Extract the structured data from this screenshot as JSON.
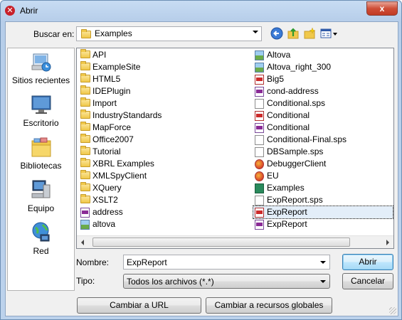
{
  "window": {
    "title": "Abrir",
    "close_glyph": "x"
  },
  "toolbar": {
    "lookin_label": "Buscar en:",
    "lookin_value": "Examples",
    "icons": [
      "back-icon",
      "up-folder-icon",
      "new-folder-icon",
      "view-menu-icon"
    ]
  },
  "places": [
    {
      "label": "Sitios recientes",
      "icon": "recent-places-icon"
    },
    {
      "label": "Escritorio",
      "icon": "desktop-icon"
    },
    {
      "label": "Bibliotecas",
      "icon": "libraries-icon"
    },
    {
      "label": "Equipo",
      "icon": "computer-icon"
    },
    {
      "label": "Red",
      "icon": "network-icon"
    }
  ],
  "files_col1": [
    {
      "name": "API",
      "type": "folder"
    },
    {
      "name": "ExampleSite",
      "type": "folder"
    },
    {
      "name": "HTML5",
      "type": "folder"
    },
    {
      "name": "IDEPlugin",
      "type": "folder"
    },
    {
      "name": "Import",
      "type": "folder"
    },
    {
      "name": "IndustryStandards",
      "type": "folder"
    },
    {
      "name": "MapForce",
      "type": "folder"
    },
    {
      "name": "Office2007",
      "type": "folder"
    },
    {
      "name": "Tutorial",
      "type": "folder"
    },
    {
      "name": "XBRL Examples",
      "type": "folder"
    },
    {
      "name": "XMLSpyClient",
      "type": "folder"
    },
    {
      "name": "XQuery",
      "type": "folder"
    },
    {
      "name": "XSLT2",
      "type": "folder"
    },
    {
      "name": "address",
      "type": "xml"
    },
    {
      "name": "altova",
      "type": "img"
    }
  ],
  "files_col2": [
    {
      "name": "Altova",
      "type": "img"
    },
    {
      "name": "Altova_right_300",
      "type": "img"
    },
    {
      "name": "Big5",
      "type": "red"
    },
    {
      "name": "cond-address",
      "type": "xml"
    },
    {
      "name": "Conditional.sps",
      "type": "doc"
    },
    {
      "name": "Conditional",
      "type": "red"
    },
    {
      "name": "Conditional",
      "type": "xml"
    },
    {
      "name": "Conditional-Final.sps",
      "type": "doc"
    },
    {
      "name": "DBSample.sps",
      "type": "doc"
    },
    {
      "name": "DebuggerClient",
      "type": "ff"
    },
    {
      "name": "EU",
      "type": "ff"
    },
    {
      "name": "Examples",
      "type": "green"
    },
    {
      "name": "ExpReport.sps",
      "type": "doc"
    },
    {
      "name": "ExpReport",
      "type": "red",
      "selected": true
    },
    {
      "name": "ExpReport",
      "type": "xml"
    }
  ],
  "form": {
    "filename_label": "Nombre:",
    "filename_value": "ExpReport",
    "filetype_label": "Tipo:",
    "filetype_value": "Todos los archivos (*.*)",
    "open_button": "Abrir",
    "cancel_button": "Cancelar",
    "url_button": "Cambiar a URL",
    "global_button": "Cambiar a recursos globales"
  }
}
